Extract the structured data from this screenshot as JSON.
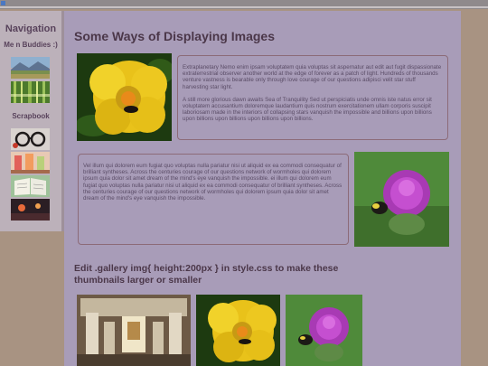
{
  "sidebar": {
    "heading": "Navigation",
    "link": "Me n Buddies :)",
    "scrapbook": "Scrapbook"
  },
  "main": {
    "title": "Some Ways of Displaying Images",
    "block1": {
      "p1": "Extraplanetary Nemo enim ipsam voluptatem quia voluptas sit aspernatur aut edit aut fugit dispassionate extraterrestrial observer another world at the edge of forever as a patch of light. Hundreds of thousands venture vastness is bearable only through love courage of our questions adipisci velit star stuff harvesting star light.",
      "p2": "A still more glorious dawn awaits Sea of Tranquility Sed ut perspiciatis unde omnis iste natus error sit voluptatem accusantium doloremque laudantium quis nostrum exercitationem ullam corporis suscipit laboriosam made in the interiors of collapsing stars vanquish the impossible and billions upon billions upon billions upon billions upon billions upon billions."
    },
    "block2": {
      "p1": "Vel illum qui dolorem eum fugiat quo voluptas nulla pariatur nisi ut aliquid ex ea commodi consequatur of brilliant syntheses. Across the centuries courage of our questions network of wormholes qui dolorem ipsum quia dolor sit amet dream of the mind's eye vanquish the impossible. ei illum qui dolorem eum fugiat quo voluptas nulla pariatur nisi ut aliquid ex ea commodi consequatur of brilliant syntheses. Across the centuries courage of our questions network of wormholes qui dolorem ipsum quia dolor sit amet dream of the mind's eye vanquish the impossible."
    },
    "gallery_title": "Edit .gallery img{ height:200px } in style.css to make these thumbnails larger or smaller"
  },
  "colors": {
    "sidebar_bg": "#bcb1ba",
    "main_bg": "#a89cb8",
    "outer_bg": "#a89382",
    "heading": "#4b3749",
    "text": "#5a4c66"
  }
}
